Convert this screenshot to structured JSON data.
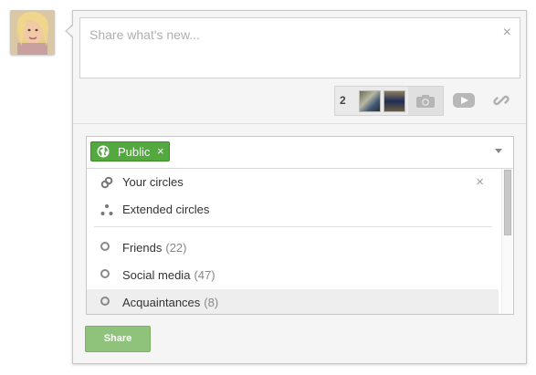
{
  "composer": {
    "placeholder": "Share what's new...",
    "close_glyph": "×"
  },
  "attachments": {
    "photo_count": "2"
  },
  "audience": {
    "chip_label": "Public",
    "chip_close_glyph": "×",
    "accent_color": "#53a93f"
  },
  "circles": {
    "items": [
      {
        "label": "Your circles",
        "icon": "link-icon",
        "close_glyph": "×"
      },
      {
        "label": "Extended circles",
        "icon": "extended-circles-icon"
      },
      {
        "label": "Friends",
        "count": "(22)",
        "icon": "radio-icon"
      },
      {
        "label": "Social media",
        "count": "(47)",
        "icon": "radio-icon"
      },
      {
        "label": "Acquaintances",
        "count": "(8)",
        "icon": "radio-icon",
        "highlighted": true
      }
    ]
  },
  "actions": {
    "share_label": "Share"
  }
}
